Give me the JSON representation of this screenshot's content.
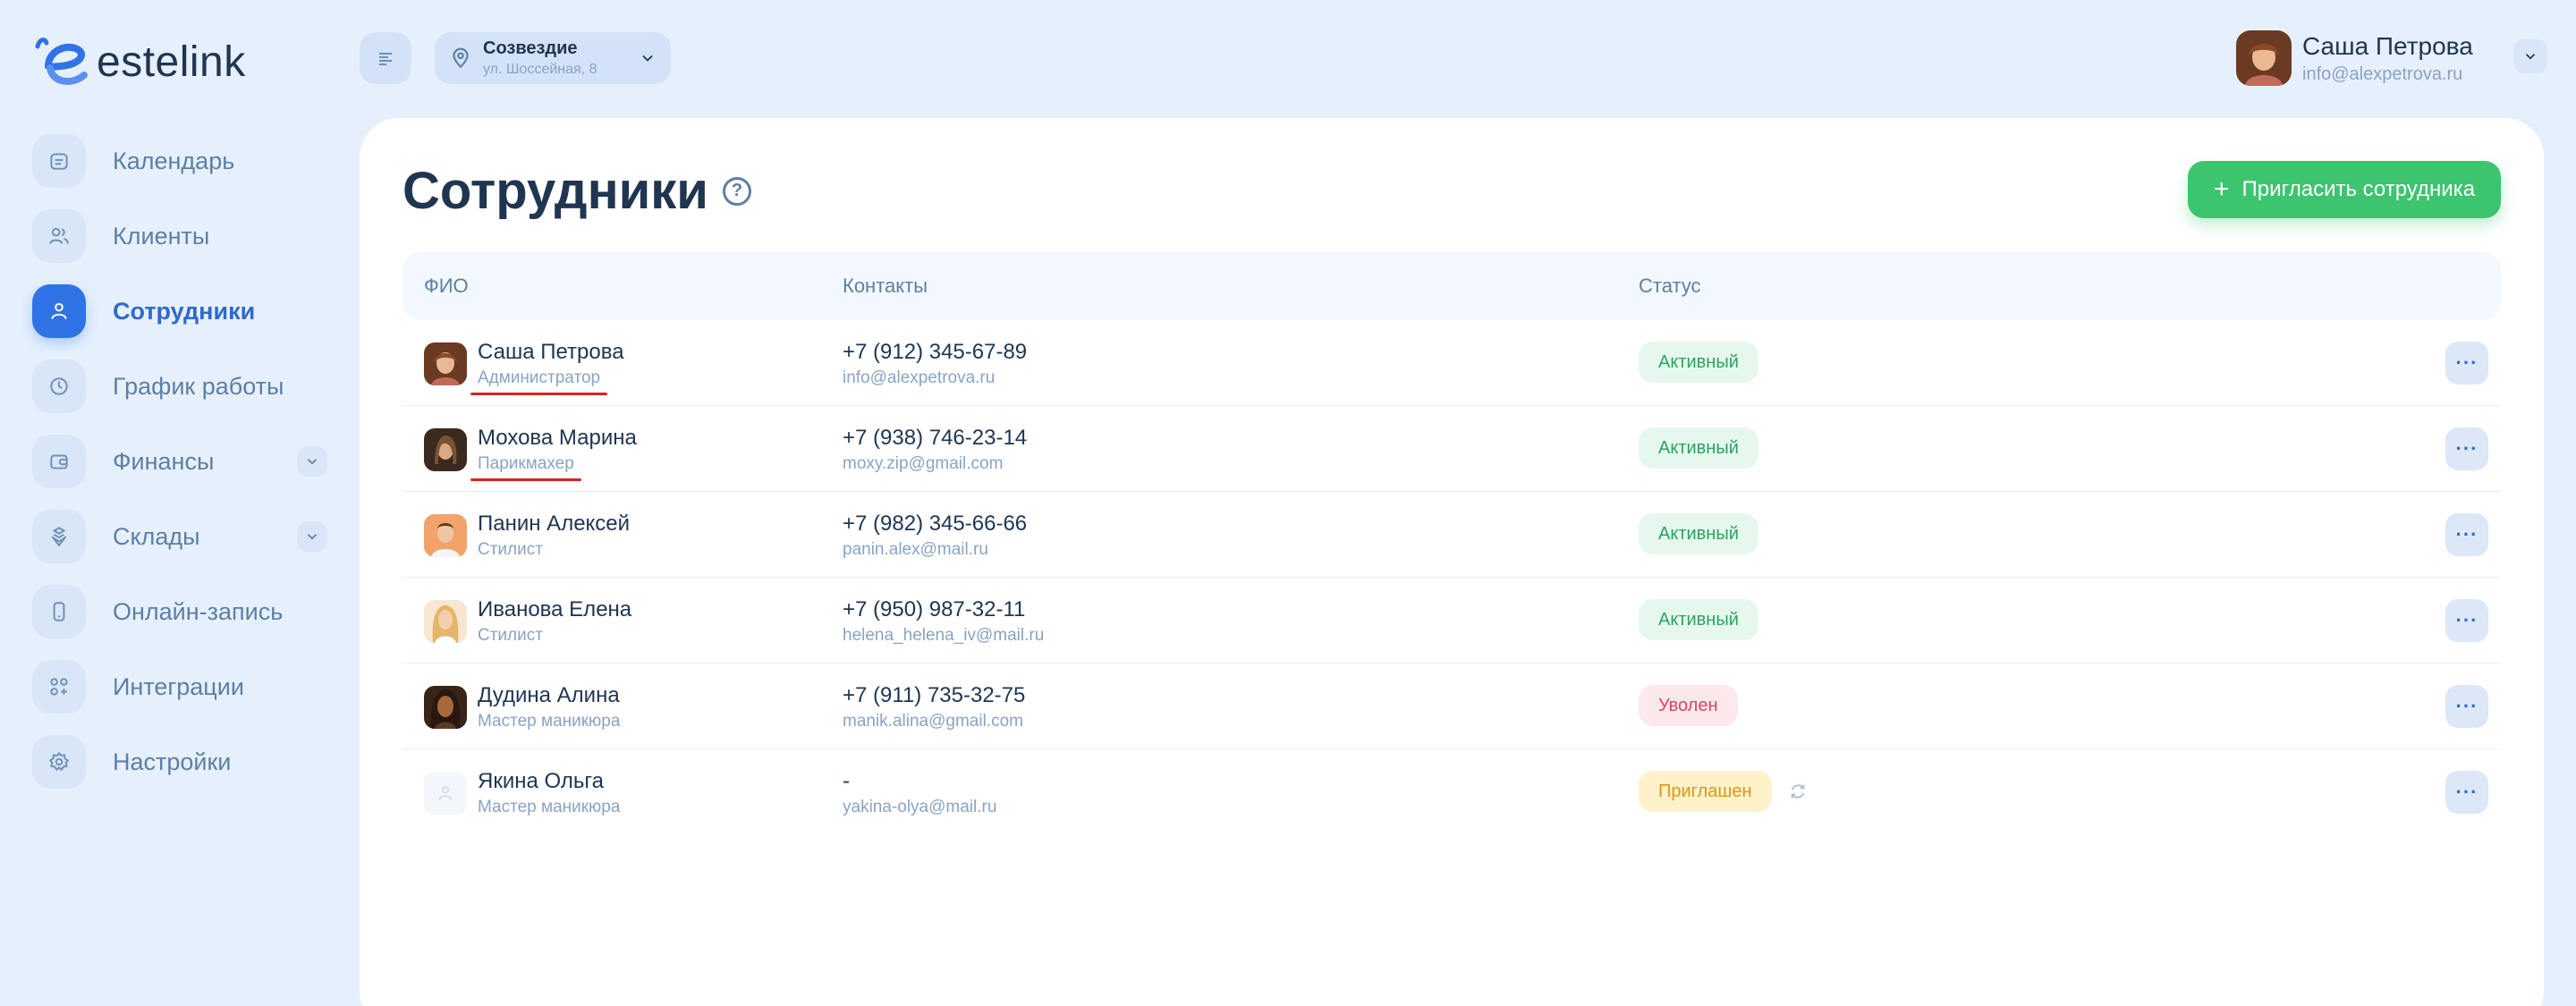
{
  "brand": {
    "name": "estelink",
    "accent": "#2f73e6"
  },
  "sidebar": {
    "items": [
      {
        "label": "Календарь",
        "icon": "calendar-icon",
        "active": false,
        "expandable": false
      },
      {
        "label": "Клиенты",
        "icon": "clients-icon",
        "active": false,
        "expandable": false
      },
      {
        "label": "Сотрудники",
        "icon": "employee-icon",
        "active": true,
        "expandable": false
      },
      {
        "label": "График работы",
        "icon": "clock-icon",
        "active": false,
        "expandable": false
      },
      {
        "label": "Финансы",
        "icon": "wallet-icon",
        "active": false,
        "expandable": true
      },
      {
        "label": "Склады",
        "icon": "boxes-icon",
        "active": false,
        "expandable": true
      },
      {
        "label": "Онлайн-запись",
        "icon": "phone-icon",
        "active": false,
        "expandable": false
      },
      {
        "label": "Интеграции",
        "icon": "integrations-icon",
        "active": false,
        "expandable": false
      },
      {
        "label": "Настройки",
        "icon": "settings-icon",
        "active": false,
        "expandable": false
      }
    ]
  },
  "header": {
    "location": {
      "name": "Созвездие",
      "address": "ул. Шоссейная, 8"
    },
    "user": {
      "name": "Саша Петрова",
      "email": "info@alexpetrova.ru"
    }
  },
  "main": {
    "title": "Сотрудники",
    "invite_label": "Пригласить сотрудника",
    "columns": {
      "name": "ФИО",
      "contacts": "Контакты",
      "status": "Статус"
    },
    "rows": [
      {
        "name": "Саша Петрова",
        "role": "Администратор",
        "phone": "+7 (912) 345-67-89",
        "email": "info@alexpetrova.ru",
        "status": "Активный",
        "status_type": "active"
      },
      {
        "name": "Мохова Марина",
        "role": "Парикмахер",
        "phone": "+7 (938) 746-23-14",
        "email": "moxy.zip@gmail.com",
        "status": "Активный",
        "status_type": "active"
      },
      {
        "name": "Панин Алексей",
        "role": "Стилист",
        "phone": "+7 (982) 345-66-66",
        "email": "panin.alex@mail.ru",
        "status": "Активный",
        "status_type": "active"
      },
      {
        "name": "Иванова Елена",
        "role": "Стилист",
        "phone": "+7 (950) 987-32-11",
        "email": "helena_helena_iv@mail.ru",
        "status": "Активный",
        "status_type": "active"
      },
      {
        "name": "Дудина Алина",
        "role": "Мастер маникюра",
        "phone": "+7 (911) 735-32-75",
        "email": "manik.alina@gmail.com",
        "status": "Уволен",
        "status_type": "fired"
      },
      {
        "name": "Якина Ольга",
        "role": "Мастер маникюра",
        "phone": "-",
        "email": "yakina-olya@mail.ru",
        "status": "Приглашен",
        "status_type": "invited"
      }
    ],
    "more_label": "···"
  }
}
